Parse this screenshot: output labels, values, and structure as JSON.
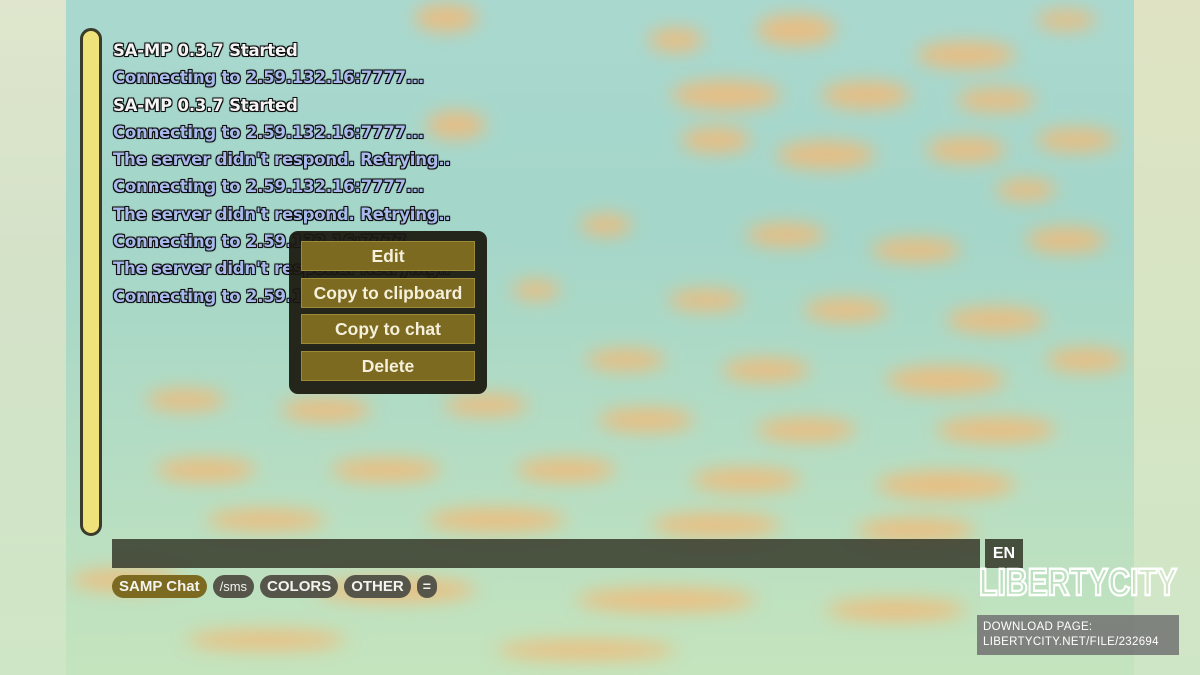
{
  "chat": {
    "lines": [
      {
        "text": "SA-MP 0.3.7 Started",
        "color": "#f4f4f4"
      },
      {
        "text": "Connecting to 2.59.132.16:7777...",
        "color": "#a8b9ec"
      },
      {
        "text": "SA-MP 0.3.7 Started",
        "color": "#f4f4f4"
      },
      {
        "text": "Connecting to 2.59.132.16:7777...",
        "color": "#a8b9ec"
      },
      {
        "text": "The server didn't respond. Retrying..",
        "color": "#a8b9ec"
      },
      {
        "text": "Connecting to 2.59.132.16:7777...",
        "color": "#a8b9ec"
      },
      {
        "text": "The server didn't respond. Retrying..",
        "color": "#a8b9ec"
      },
      {
        "text": "Connecting to 2.59.132.16:7777...",
        "color": "#a8b9ec"
      },
      {
        "text": "The server didn't respond. Retrying..",
        "color": "#a8b9ec"
      },
      {
        "text": "Connecting to 2.59.132.16:7777...",
        "color": "#a8b9ec"
      }
    ]
  },
  "context_menu": {
    "items": [
      "Edit",
      "Copy to clipboard",
      "Copy to chat",
      "Delete"
    ]
  },
  "input": {
    "value": "",
    "language": "EN"
  },
  "quick_bar": {
    "items": [
      "SAMP Chat",
      "/sms",
      "COLORS",
      "OTHER",
      "="
    ],
    "active_index": 0
  },
  "watermark": {
    "logo_text": "LIBERTYCITY",
    "line1": "DOWNLOAD PAGE:",
    "line2": "LIBERTYCITY.NET/FILE/232694"
  },
  "colors": {
    "accent": "#7c6a20",
    "scrollbar": "#f0e27a",
    "system_text": "#f4f4f4",
    "info_text": "#a8b9ec"
  }
}
